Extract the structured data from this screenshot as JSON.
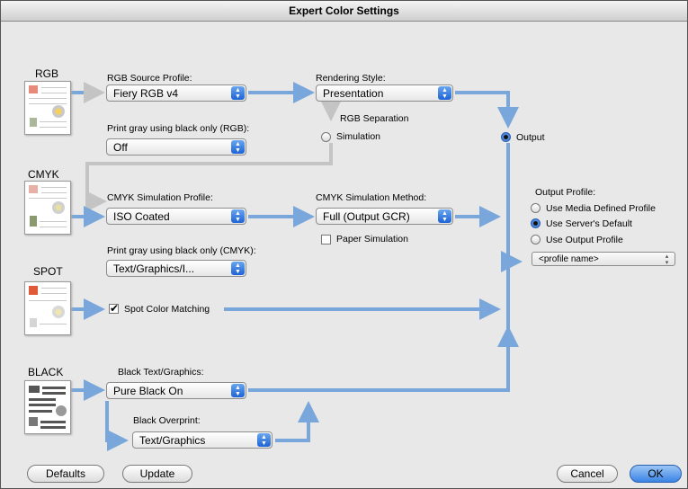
{
  "window": {
    "title": "Expert Color Settings"
  },
  "sections": {
    "rgb": "RGB",
    "cmyk": "CMYK",
    "spot": "SPOT",
    "black": "BLACK"
  },
  "rgb": {
    "source_profile_label": "RGB Source Profile:",
    "source_profile_value": "Fiery RGB v4",
    "gray_black_label": "Print gray using black only (RGB):",
    "gray_black_value": "Off",
    "rendering_style_label": "Rendering Style:",
    "rendering_style_value": "Presentation",
    "separation_label": "RGB Separation",
    "simulation_label": "Simulation",
    "output_label": "Output"
  },
  "cmyk": {
    "simulation_profile_label": "CMYK Simulation Profile:",
    "simulation_profile_value": "ISO Coated",
    "simulation_method_label": "CMYK Simulation Method:",
    "simulation_method_value": "Full (Output GCR)",
    "paper_simulation_label": "Paper Simulation",
    "gray_black_label": "Print gray using black only (CMYK):",
    "gray_black_value": "Text/Graphics/I..."
  },
  "spot": {
    "matching_label": "Spot Color Matching",
    "matching_checked": true
  },
  "black": {
    "text_graphics_label": "Black Text/Graphics:",
    "text_graphics_value": "Pure Black On",
    "overprint_label": "Black Overprint:",
    "overprint_value": "Text/Graphics"
  },
  "output_profile": {
    "label": "Output Profile:",
    "options": [
      "Use Media Defined Profile",
      "Use Server's Default",
      "Use Output Profile"
    ],
    "selected": "Use Server's Default",
    "profile_name": "<profile name>"
  },
  "buttons": {
    "defaults": "Defaults",
    "update": "Update",
    "cancel": "Cancel",
    "ok": "OK"
  },
  "colors": {
    "flow_arrow": "#7aa7db",
    "disabled_flow": "#c4c4c4",
    "accent": "#2a69d0"
  },
  "icons": {
    "popup_arrows": "updown-arrows-icon",
    "document": "document-thumbnail-icon"
  }
}
